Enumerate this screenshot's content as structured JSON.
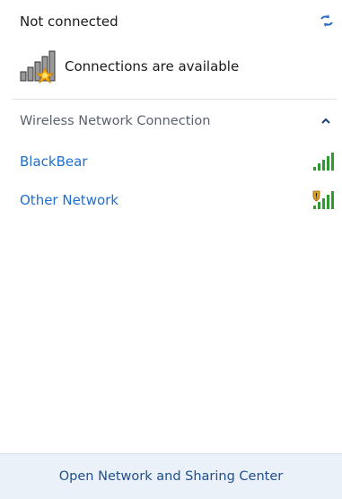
{
  "status": {
    "title": "Not connected",
    "subtitle": "Connections are available",
    "refresh_icon": "refresh-arrows-icon",
    "connection_icon": "network-bars-with-star-icon"
  },
  "wireless": {
    "header_label": "Wireless Network Connection",
    "collapse_icon": "chevron-up-icon",
    "networks": [
      {
        "name": "BlackBear",
        "icon": "wifi-signal-icon",
        "secured": false,
        "bar_color": "#2f9a2f"
      },
      {
        "name": "Other Network",
        "icon": "wifi-signal-shield-icon",
        "secured": true,
        "bar_color": "#2f9a2f"
      }
    ]
  },
  "footer": {
    "link_label": "Open Network and Sharing Center"
  },
  "colors": {
    "link_blue": "#1f6fd1",
    "footer_bg": "#eaf1f9",
    "section_gray": "#5a6270",
    "signal_green": "#2f9a2f",
    "shield_orange": "#e3a21a"
  }
}
